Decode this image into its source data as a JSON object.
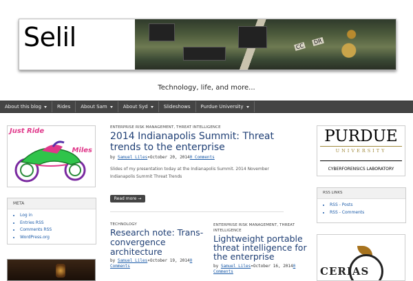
{
  "header": {
    "site_title": "Selil",
    "tagline": "Technology, life, and more...",
    "photo_labels": [
      "CC",
      "DR"
    ]
  },
  "nav": {
    "items": [
      {
        "label": "About this blog",
        "has_dropdown": true
      },
      {
        "label": "Rides",
        "has_dropdown": false
      },
      {
        "label": "About Sam",
        "has_dropdown": true
      },
      {
        "label": "About Syd",
        "has_dropdown": true
      },
      {
        "label": "Slideshows",
        "has_dropdown": false
      },
      {
        "label": "Purdue University",
        "has_dropdown": true
      }
    ]
  },
  "left_sidebar": {
    "just_ride": {
      "line1": "Just Ride",
      "line2": "Miles"
    },
    "meta": {
      "heading": "META",
      "links": [
        "Log in",
        "Entries RSS",
        "Comments RSS",
        "WordPress.org"
      ]
    }
  },
  "posts": [
    {
      "categories": "ENTERPRISE RISK MANAGEMENT, THREAT INTELLIGENCE",
      "title_lines": [
        "2014 Indianapolis Summit: Threat",
        "trends to the enterprise"
      ],
      "by": "by",
      "author": "Samuel Liles",
      "date": "October 20, 2014",
      "comments": "0 Comments",
      "excerpt": "Slides of my presentation today at the Indianapolis Summit. 2014 November Indianapolis Summit Threat Trends",
      "read_more": "Read more →"
    },
    {
      "categories": "TECHNOLOGY",
      "title_lines": [
        "Research note: Trans-",
        "convergence",
        "architecture"
      ],
      "by": "by",
      "author": "Samuel Liles",
      "date": "October 19, 2014",
      "comments_line1": "0",
      "comments_line2": "Comments"
    },
    {
      "categories_line1": "ENTERPRISE RISK MANAGEMENT, THREAT",
      "categories_line2": "INTELLIGENCE",
      "title_lines": [
        "Lightweight portable",
        "threat intelligence for",
        "the enterprise"
      ],
      "by": "by",
      "author": "Samuel Liles",
      "date": "October 16, 2014",
      "comments_line1": "0",
      "comments_line2": "Comments"
    }
  ],
  "right_sidebar": {
    "purdue": {
      "name": "PURDUE",
      "university": "UNIVERSITY",
      "lab": "CYBERFORENSICS LABORATORY"
    },
    "rss_links": {
      "heading": "RSS LINKS",
      "links": [
        "RSS - Posts",
        "RSS - Comments"
      ]
    },
    "cerias": {
      "text": "CERIAS"
    }
  },
  "colors": {
    "nav_bg": "#444444",
    "link": "#1a5aa8",
    "title": "#1e3e74",
    "purdue_gold": "#a08a3c"
  }
}
